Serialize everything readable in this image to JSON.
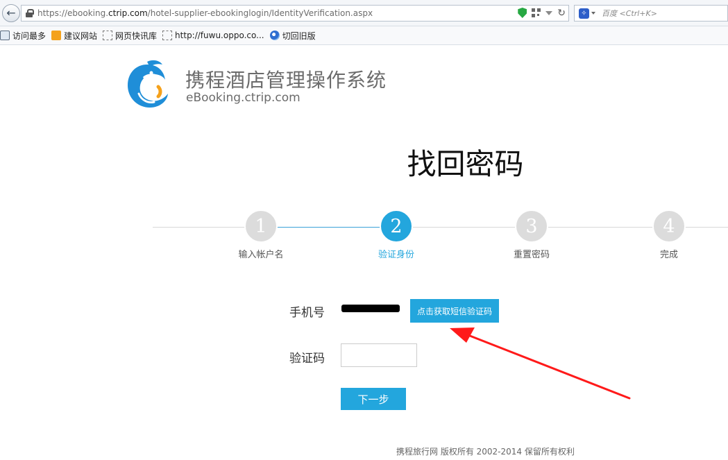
{
  "browser": {
    "url_prefix": "https://ebooking.",
    "url_host": "ctrip.com",
    "url_path": "/hotel-supplier-ebookinglogin/IdentityVerification.aspx",
    "search_placeholder": "百度 <Ctrl+K>",
    "bookmarks": [
      {
        "label": "访问最多",
        "icon": "doc-icon"
      },
      {
        "label": "建议网站",
        "icon": "orange-bookmark-icon"
      },
      {
        "label": "网页快讯库",
        "icon": "dotted-bookmark-icon"
      },
      {
        "label": "http://fuwu.oppo.co...",
        "icon": "dotted-bookmark-icon"
      },
      {
        "label": "切回旧版",
        "icon": "swirl-icon"
      }
    ]
  },
  "header": {
    "title": "携程酒店管理操作系统",
    "subtitle": "eBooking.ctrip.com"
  },
  "main": {
    "heading": "找回密码",
    "steps": [
      {
        "number": "1",
        "label": "输入帐户名",
        "active": false
      },
      {
        "number": "2",
        "label": "验证身份",
        "active": true
      },
      {
        "number": "3",
        "label": "重置密码",
        "active": false
      },
      {
        "number": "4",
        "label": "完成",
        "active": false
      }
    ],
    "phone_label": "手机号",
    "phone_value": "",
    "sms_button": "点击获取短信验证码",
    "code_label": "验证码",
    "code_value": "",
    "next_button": "下一步"
  },
  "footer": {
    "copyright": "携程旅行网 版权所有 2002-2014 保留所有权利"
  },
  "colors": {
    "accent": "#23a6dd",
    "annotation_arrow": "#ff1a1a"
  }
}
